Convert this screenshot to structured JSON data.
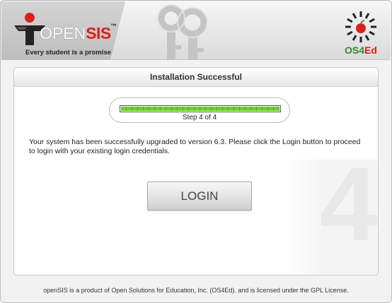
{
  "brand": {
    "name_part1": "OPEN",
    "name_part2": "SIS",
    "trademark": "™",
    "tagline": "Every student is a promise"
  },
  "partner": {
    "name_part1": "OS4",
    "name_part2": "Ed"
  },
  "panel": {
    "title": "Installation Successful",
    "step_number": "4"
  },
  "progress": {
    "value_percent": 100,
    "label": "Step 4 of 4"
  },
  "message": "Your system has been successfully upgraded to version 6.3. Please click the Login button to proceed to login with your existing login credentials.",
  "login_button": "LOGIN",
  "footer": {
    "text_before": "openSIS is a product of Open Solutions for Education, Inc. (OS4Ed). and is licensed under the ",
    "link": "GPL License",
    "text_after": "."
  },
  "colors": {
    "progress_green": "#5ec41e",
    "brand_red": "#d9221c",
    "os4ed_green": "#2f8a2e"
  }
}
